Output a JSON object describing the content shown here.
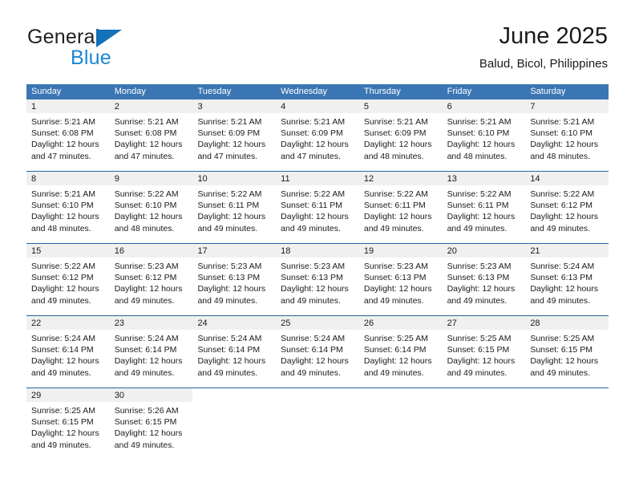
{
  "brand": {
    "name_part1": "General",
    "name_part2": "Blue",
    "triangle_color": "#1470b8",
    "blue_color": "#1b87d4"
  },
  "header": {
    "title": "June 2025",
    "subtitle": "Balud, Bicol, Philippines"
  },
  "colors": {
    "header_row_bg": "#3b76b4",
    "header_row_text": "#ffffff",
    "row_divider": "#2a63a8",
    "daynum_band_bg": "#f0f0f0"
  },
  "calendar": {
    "weekday_headers": [
      "Sunday",
      "Monday",
      "Tuesday",
      "Wednesday",
      "Thursday",
      "Friday",
      "Saturday"
    ],
    "weeks": [
      [
        {
          "day": "1",
          "sunrise": "Sunrise: 5:21 AM",
          "sunset": "Sunset: 6:08 PM",
          "daylight": "Daylight: 12 hours and 47 minutes."
        },
        {
          "day": "2",
          "sunrise": "Sunrise: 5:21 AM",
          "sunset": "Sunset: 6:08 PM",
          "daylight": "Daylight: 12 hours and 47 minutes."
        },
        {
          "day": "3",
          "sunrise": "Sunrise: 5:21 AM",
          "sunset": "Sunset: 6:09 PM",
          "daylight": "Daylight: 12 hours and 47 minutes."
        },
        {
          "day": "4",
          "sunrise": "Sunrise: 5:21 AM",
          "sunset": "Sunset: 6:09 PM",
          "daylight": "Daylight: 12 hours and 47 minutes."
        },
        {
          "day": "5",
          "sunrise": "Sunrise: 5:21 AM",
          "sunset": "Sunset: 6:09 PM",
          "daylight": "Daylight: 12 hours and 48 minutes."
        },
        {
          "day": "6",
          "sunrise": "Sunrise: 5:21 AM",
          "sunset": "Sunset: 6:10 PM",
          "daylight": "Daylight: 12 hours and 48 minutes."
        },
        {
          "day": "7",
          "sunrise": "Sunrise: 5:21 AM",
          "sunset": "Sunset: 6:10 PM",
          "daylight": "Daylight: 12 hours and 48 minutes."
        }
      ],
      [
        {
          "day": "8",
          "sunrise": "Sunrise: 5:21 AM",
          "sunset": "Sunset: 6:10 PM",
          "daylight": "Daylight: 12 hours and 48 minutes."
        },
        {
          "day": "9",
          "sunrise": "Sunrise: 5:22 AM",
          "sunset": "Sunset: 6:10 PM",
          "daylight": "Daylight: 12 hours and 48 minutes."
        },
        {
          "day": "10",
          "sunrise": "Sunrise: 5:22 AM",
          "sunset": "Sunset: 6:11 PM",
          "daylight": "Daylight: 12 hours and 49 minutes."
        },
        {
          "day": "11",
          "sunrise": "Sunrise: 5:22 AM",
          "sunset": "Sunset: 6:11 PM",
          "daylight": "Daylight: 12 hours and 49 minutes."
        },
        {
          "day": "12",
          "sunrise": "Sunrise: 5:22 AM",
          "sunset": "Sunset: 6:11 PM",
          "daylight": "Daylight: 12 hours and 49 minutes."
        },
        {
          "day": "13",
          "sunrise": "Sunrise: 5:22 AM",
          "sunset": "Sunset: 6:11 PM",
          "daylight": "Daylight: 12 hours and 49 minutes."
        },
        {
          "day": "14",
          "sunrise": "Sunrise: 5:22 AM",
          "sunset": "Sunset: 6:12 PM",
          "daylight": "Daylight: 12 hours and 49 minutes."
        }
      ],
      [
        {
          "day": "15",
          "sunrise": "Sunrise: 5:22 AM",
          "sunset": "Sunset: 6:12 PM",
          "daylight": "Daylight: 12 hours and 49 minutes."
        },
        {
          "day": "16",
          "sunrise": "Sunrise: 5:23 AM",
          "sunset": "Sunset: 6:12 PM",
          "daylight": "Daylight: 12 hours and 49 minutes."
        },
        {
          "day": "17",
          "sunrise": "Sunrise: 5:23 AM",
          "sunset": "Sunset: 6:13 PM",
          "daylight": "Daylight: 12 hours and 49 minutes."
        },
        {
          "day": "18",
          "sunrise": "Sunrise: 5:23 AM",
          "sunset": "Sunset: 6:13 PM",
          "daylight": "Daylight: 12 hours and 49 minutes."
        },
        {
          "day": "19",
          "sunrise": "Sunrise: 5:23 AM",
          "sunset": "Sunset: 6:13 PM",
          "daylight": "Daylight: 12 hours and 49 minutes."
        },
        {
          "day": "20",
          "sunrise": "Sunrise: 5:23 AM",
          "sunset": "Sunset: 6:13 PM",
          "daylight": "Daylight: 12 hours and 49 minutes."
        },
        {
          "day": "21",
          "sunrise": "Sunrise: 5:24 AM",
          "sunset": "Sunset: 6:13 PM",
          "daylight": "Daylight: 12 hours and 49 minutes."
        }
      ],
      [
        {
          "day": "22",
          "sunrise": "Sunrise: 5:24 AM",
          "sunset": "Sunset: 6:14 PM",
          "daylight": "Daylight: 12 hours and 49 minutes."
        },
        {
          "day": "23",
          "sunrise": "Sunrise: 5:24 AM",
          "sunset": "Sunset: 6:14 PM",
          "daylight": "Daylight: 12 hours and 49 minutes."
        },
        {
          "day": "24",
          "sunrise": "Sunrise: 5:24 AM",
          "sunset": "Sunset: 6:14 PM",
          "daylight": "Daylight: 12 hours and 49 minutes."
        },
        {
          "day": "25",
          "sunrise": "Sunrise: 5:24 AM",
          "sunset": "Sunset: 6:14 PM",
          "daylight": "Daylight: 12 hours and 49 minutes."
        },
        {
          "day": "26",
          "sunrise": "Sunrise: 5:25 AM",
          "sunset": "Sunset: 6:14 PM",
          "daylight": "Daylight: 12 hours and 49 minutes."
        },
        {
          "day": "27",
          "sunrise": "Sunrise: 5:25 AM",
          "sunset": "Sunset: 6:15 PM",
          "daylight": "Daylight: 12 hours and 49 minutes."
        },
        {
          "day": "28",
          "sunrise": "Sunrise: 5:25 AM",
          "sunset": "Sunset: 6:15 PM",
          "daylight": "Daylight: 12 hours and 49 minutes."
        }
      ],
      [
        {
          "day": "29",
          "sunrise": "Sunrise: 5:25 AM",
          "sunset": "Sunset: 6:15 PM",
          "daylight": "Daylight: 12 hours and 49 minutes."
        },
        {
          "day": "30",
          "sunrise": "Sunrise: 5:26 AM",
          "sunset": "Sunset: 6:15 PM",
          "daylight": "Daylight: 12 hours and 49 minutes."
        },
        {
          "day": "",
          "sunrise": "",
          "sunset": "",
          "daylight": ""
        },
        {
          "day": "",
          "sunrise": "",
          "sunset": "",
          "daylight": ""
        },
        {
          "day": "",
          "sunrise": "",
          "sunset": "",
          "daylight": ""
        },
        {
          "day": "",
          "sunrise": "",
          "sunset": "",
          "daylight": ""
        },
        {
          "day": "",
          "sunrise": "",
          "sunset": "",
          "daylight": ""
        }
      ]
    ]
  }
}
